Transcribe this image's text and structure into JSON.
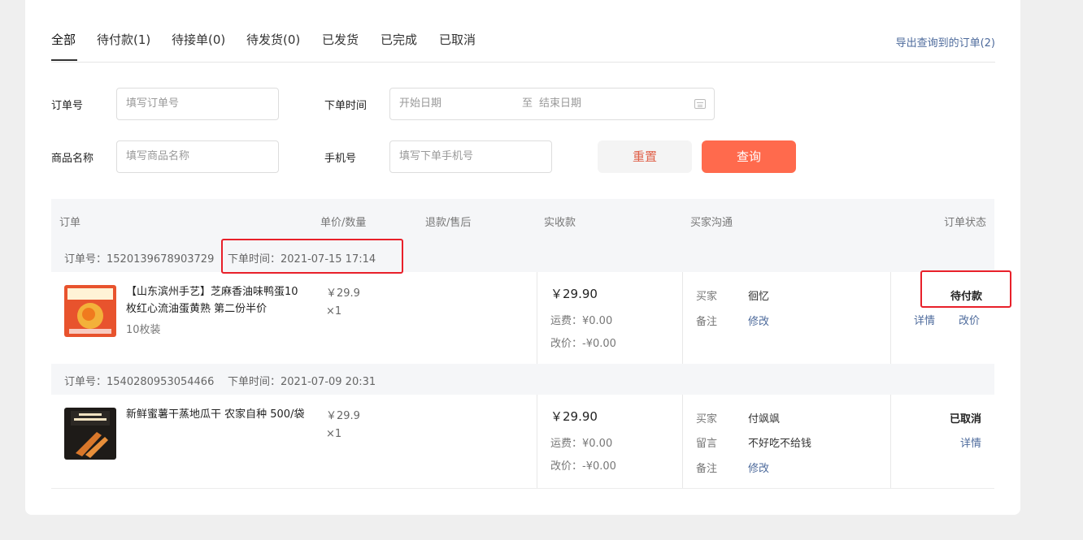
{
  "tabs": [
    "全部",
    "待付款(1)",
    "待接单(0)",
    "待发货(0)",
    "已发货",
    "已完成",
    "已取消"
  ],
  "export_label": "导出查询到的订单(2)",
  "filters": {
    "order_no_label": "订单号",
    "order_no_placeholder": "填写订单号",
    "time_label": "下单时间",
    "start_placeholder": "开始日期",
    "sep": "至",
    "end_placeholder": "结束日期",
    "product_label": "商品名称",
    "product_placeholder": "填写商品名称",
    "phone_label": "手机号",
    "phone_placeholder": "填写下单手机号",
    "reset": "重置",
    "query": "查询"
  },
  "columns": [
    "订单",
    "单价/数量",
    "退款/售后",
    "实收款",
    "买家沟通",
    "订单状态"
  ],
  "orders": [
    {
      "order_no": "订单号：1520139678903729",
      "time": "下单时间：2021-07-15 17:14",
      "title": "【山东滨州手艺】芝麻香油味鸭蛋10枚红心流油蛋黄熟 第二份半价",
      "spec": "10枚装",
      "unit_price": "￥29.9",
      "qty": "×1",
      "received": "￥29.90",
      "shipping": "运费：¥0.00",
      "adjust": "改价：-¥0.00",
      "buyer_key": "买家",
      "buyer": "徊忆",
      "note_key": "备注",
      "note_action": "修改",
      "status": "待付款",
      "action1": "详情",
      "action2": "改价"
    },
    {
      "order_no": "订单号：1540280953054466",
      "time": "下单时间：2021-07-09 20:31",
      "title": "新鲜蜜薯干蒸地瓜干 农家自种 500/袋",
      "unit_price": "￥29.9",
      "qty": "×1",
      "received": "￥29.90",
      "shipping": "运费：¥0.00",
      "adjust": "改价：-¥0.00",
      "buyer_key": "买家",
      "buyer": "付飒飒",
      "msg_key": "留言",
      "msg": "不好吃不给钱",
      "note_key": "备注",
      "note_action": "修改",
      "status": "已取消",
      "action1": "详情"
    }
  ],
  "colors": {
    "accent": "#ff6a4d",
    "link": "#4e6b9c",
    "highlight": "#e8202a"
  }
}
